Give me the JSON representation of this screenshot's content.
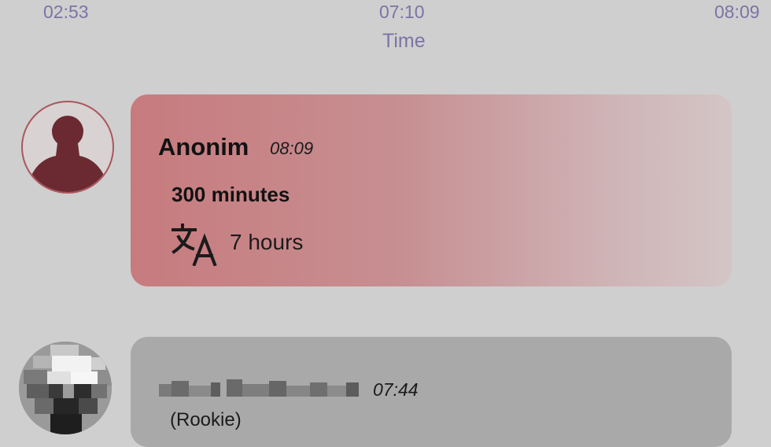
{
  "time_axis": {
    "ticks": [
      "02:53",
      "07:10",
      "08:09"
    ],
    "title": "Time"
  },
  "messages": [
    {
      "author": "Anonim",
      "time": "08:09",
      "text": "300 minutes",
      "translation": "7 hours",
      "avatar_icon": "default-person-icon",
      "translate_icon": "translate-icon",
      "accent_color": "#c77b7e"
    },
    {
      "time": "07:44",
      "role": "(Rookie)",
      "avatar_icon": "pixelated-photo-avatar",
      "background_color": "#a9a9a9"
    }
  ]
}
